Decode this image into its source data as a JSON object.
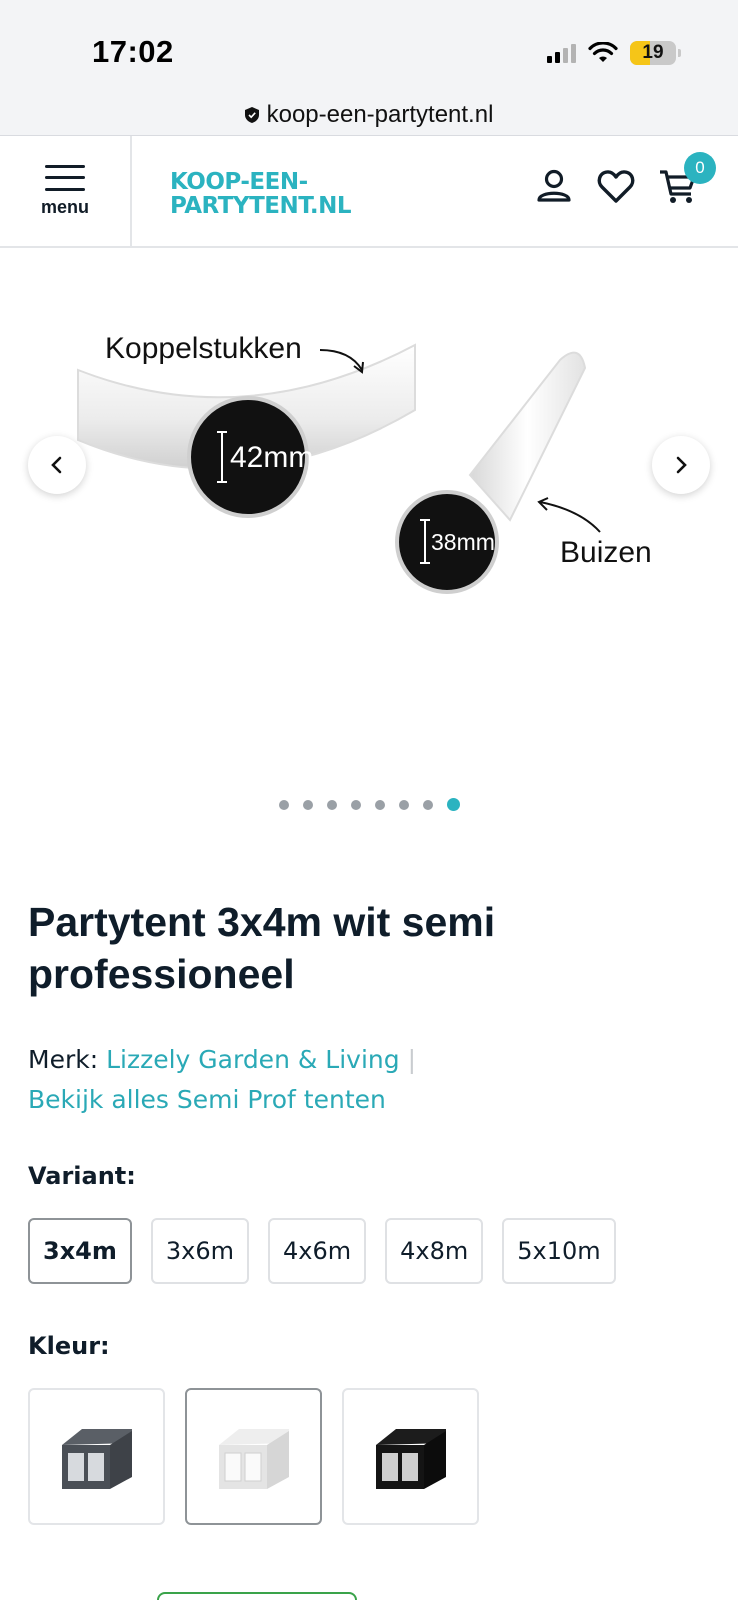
{
  "status_bar": {
    "time": "17:02",
    "battery": "19"
  },
  "browser": {
    "url": "koop-een-partytent.nl"
  },
  "header": {
    "menu_label": "menu",
    "logo_line1": "KOOP-EEN-",
    "logo_line2": "PARTYTENT.NL",
    "cart_count": "0",
    "icons": [
      "user-icon",
      "heart-icon",
      "cart-icon"
    ]
  },
  "gallery": {
    "image_labels": {
      "couplers": "Koppelstukken",
      "couplers_size": "42mm",
      "tubes": "Buizen",
      "tubes_size": "38mm"
    },
    "slide_count": 8,
    "active_slide": 7
  },
  "product": {
    "title": "Partytent 3x4m wit semi professioneel",
    "brand_label": "Merk:",
    "brand_name": "Lizzely Garden & Living",
    "separator": "|",
    "view_all": "Bekijk alles Semi Prof tenten"
  },
  "variant": {
    "label": "Variant:",
    "options": [
      "3x4m",
      "3x6m",
      "4x6m",
      "4x8m",
      "5x10m"
    ],
    "selected": "3x4m"
  },
  "color": {
    "label": "Kleur:",
    "options": [
      "grey",
      "white",
      "black"
    ],
    "selected": "white"
  },
  "colors": {
    "accent": "#2bb3c0",
    "link": "#2aa9b6",
    "text": "#0f1d2a"
  }
}
